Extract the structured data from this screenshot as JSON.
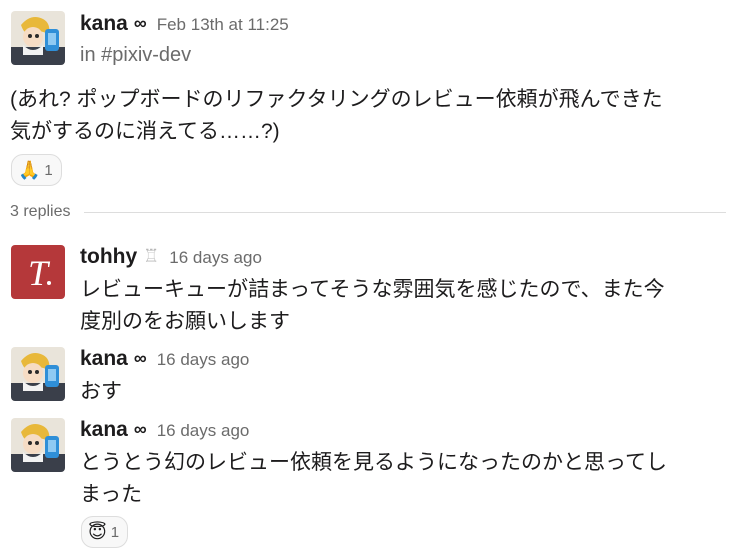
{
  "parent": {
    "author": "kana",
    "status_emoji": "∞",
    "timestamp": "Feb 13th at 11:25",
    "channel": "in #pixiv-dev",
    "message_line1": "(あれ? ポップボードのリファクタリングのレビュー依頼が飛んできた",
    "message_line2": "気がするのに消えてる……?)",
    "reaction": {
      "emoji": "🙏",
      "count": "1"
    }
  },
  "thread": {
    "replies_label": "3 replies",
    "replies": [
      {
        "author": "tohhy",
        "status_emoji": "♖",
        "timestamp": "16 days ago",
        "line1": "レビューキューが詰まってそうな雰囲気を感じたので、また今",
        "line2": "度別のをお願いします"
      },
      {
        "author": "kana",
        "status_emoji": "∞",
        "timestamp": "16 days ago",
        "line1": "おす"
      },
      {
        "author": "kana",
        "status_emoji": "∞",
        "timestamp": "16 days ago",
        "line1": "とうとう幻のレビュー依頼を見るようになったのかと思ってし",
        "line2": "まった",
        "reaction": {
          "emoji": "😇",
          "count": "1"
        }
      }
    ]
  },
  "colors": {
    "tohhy_avatar": "#b5383a",
    "timestamp": "#6b6b6b",
    "divider": "#dddddd"
  },
  "icons": {
    "kana_avatar": "anime-character-avatar",
    "tohhy_avatar": "red-t-logo-avatar"
  }
}
